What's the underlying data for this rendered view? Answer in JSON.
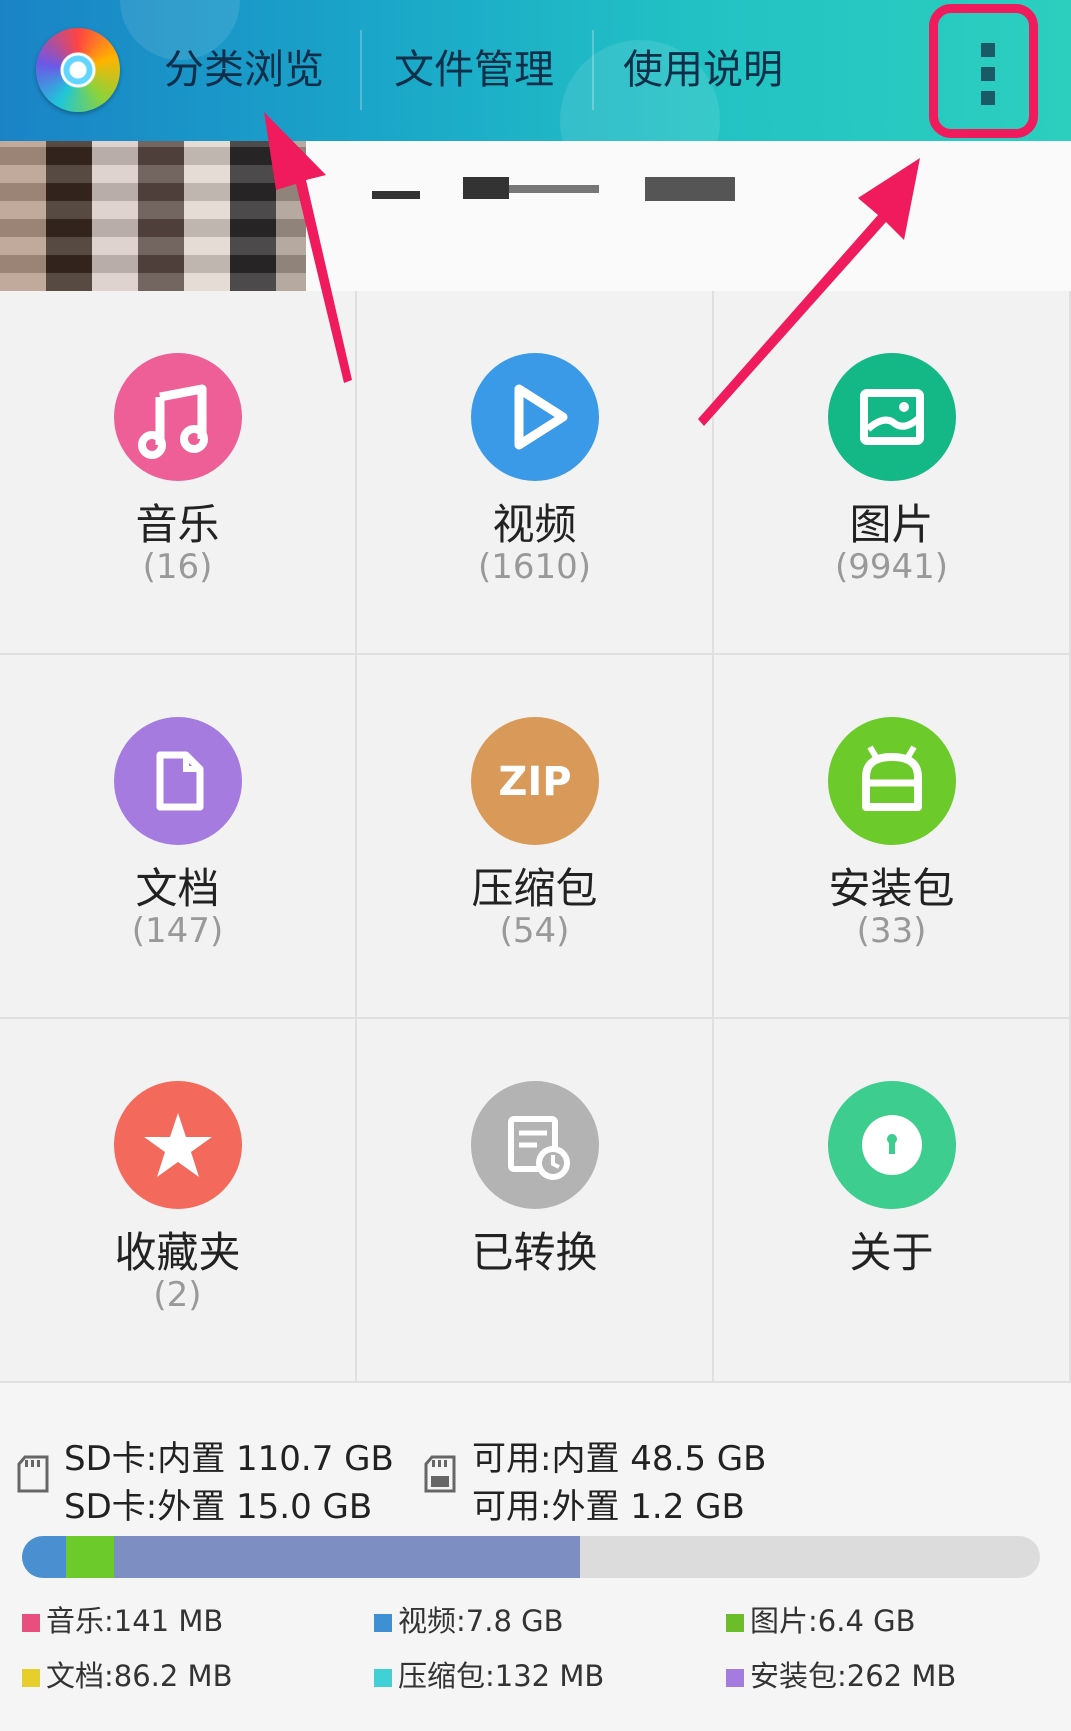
{
  "header": {
    "tabs": [
      {
        "label": "分类浏览"
      },
      {
        "label": "文件管理"
      },
      {
        "label": "使用说明"
      }
    ]
  },
  "categories": [
    {
      "label": "音乐",
      "count": "(16)",
      "icon": "music-icon",
      "color": "#ee5f98"
    },
    {
      "label": "视频",
      "count": "(1610)",
      "icon": "play-icon",
      "color": "#3b9ae8"
    },
    {
      "label": "图片",
      "count": "(9941)",
      "icon": "image-icon",
      "color": "#14b887"
    },
    {
      "label": "文档",
      "count": "(147)",
      "icon": "document-icon",
      "color": "#a57bdf"
    },
    {
      "label": "压缩包",
      "count": "(54)",
      "icon": "zip-icon",
      "color": "#d99a59"
    },
    {
      "label": "安装包",
      "count": "(33)",
      "icon": "android-icon",
      "color": "#6ccb2a"
    },
    {
      "label": "收藏夹",
      "count": "(2)",
      "icon": "star-icon",
      "color": "#f36a5c"
    },
    {
      "label": "已转换",
      "count": "",
      "icon": "converted-file-icon",
      "color": "#b3b3b3"
    },
    {
      "label": "关于",
      "count": "",
      "icon": "info-icon",
      "color": "#3ccd8f"
    }
  ],
  "storage": {
    "sd_internal": "SD卡:内置 110.7 GB",
    "sd_external": "SD卡:外置 15.0 GB",
    "free_internal": "可用:内置 48.5 GB",
    "free_external": "可用:外置 1.2 GB",
    "usage_bar": [
      {
        "name": "视频",
        "fraction": 0.043,
        "color": "#4a90d0"
      },
      {
        "name": "图片",
        "fraction": 0.047,
        "color": "#6ccb2a"
      },
      {
        "name": "other",
        "fraction": 0.458,
        "color": "#7d8fc2"
      }
    ],
    "legend": [
      {
        "label": "音乐:141 MB",
        "color": "#e84f7e"
      },
      {
        "label": "视频:7.8 GB",
        "color": "#3f8fd4"
      },
      {
        "label": "图片:6.4 GB",
        "color": "#6cbd2a"
      },
      {
        "label": "文档:86.2 MB",
        "color": "#e6cf2a"
      },
      {
        "label": "压缩包:132 MB",
        "color": "#41d0d6"
      },
      {
        "label": "安装包:262 MB",
        "color": "#a57bdf"
      }
    ]
  }
}
